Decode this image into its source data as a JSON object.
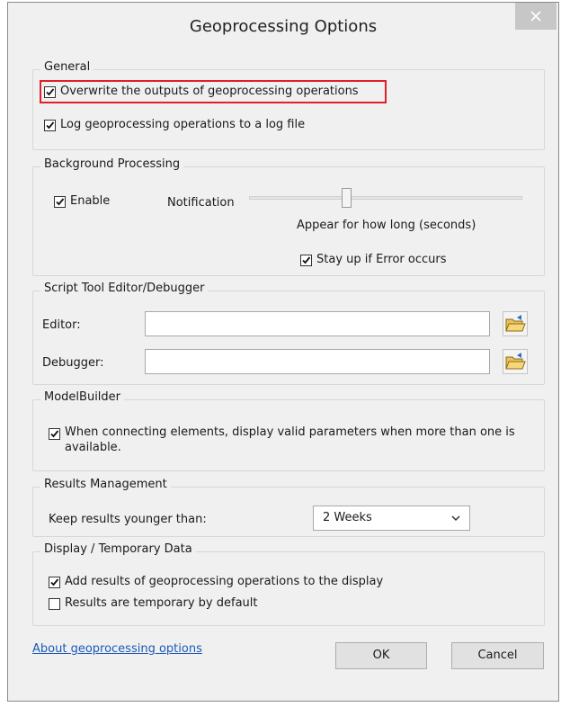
{
  "window": {
    "title": "Geoprocessing Options"
  },
  "general": {
    "legend": "General",
    "overwrite": {
      "label": "Overwrite the outputs of geoprocessing operations",
      "checked": true
    },
    "log": {
      "label": "Log geoprocessing operations to a log file",
      "checked": true
    }
  },
  "background": {
    "legend": "Background Processing",
    "enable": {
      "label": "Enable",
      "checked": true
    },
    "notification_label": "Notification",
    "slider_caption": "Appear for how long (seconds)",
    "stay_up": {
      "label": "Stay up if Error occurs",
      "checked": true
    }
  },
  "script_tool": {
    "legend": "Script Tool Editor/Debugger",
    "editor_label": "Editor:",
    "editor_value": "",
    "debugger_label": "Debugger:",
    "debugger_value": ""
  },
  "modelbuilder": {
    "legend": "ModelBuilder",
    "option": {
      "label_line1": "When connecting elements, display valid parameters when more than one is",
      "label_line2": "available.",
      "checked": true
    }
  },
  "results": {
    "legend": "Results Management",
    "keep_label": "Keep results younger than:",
    "keep_value": "2 Weeks"
  },
  "display": {
    "legend": "Display / Temporary Data",
    "add_results": {
      "label": "Add results of geoprocessing operations to the display",
      "checked": true
    },
    "temporary": {
      "label": "Results are temporary by default",
      "checked": false
    }
  },
  "footer": {
    "about_link": "About geoprocessing options",
    "ok": "OK",
    "cancel": "Cancel"
  },
  "colors": {
    "highlight": "#e0202a",
    "link": "#1a5ab8",
    "dialog_bg": "#f0f0f0"
  },
  "icons": {
    "close": "close-icon",
    "check": "checkmark-icon",
    "folder": "folder-browse-icon",
    "dropdown": "chevron-down-icon"
  }
}
